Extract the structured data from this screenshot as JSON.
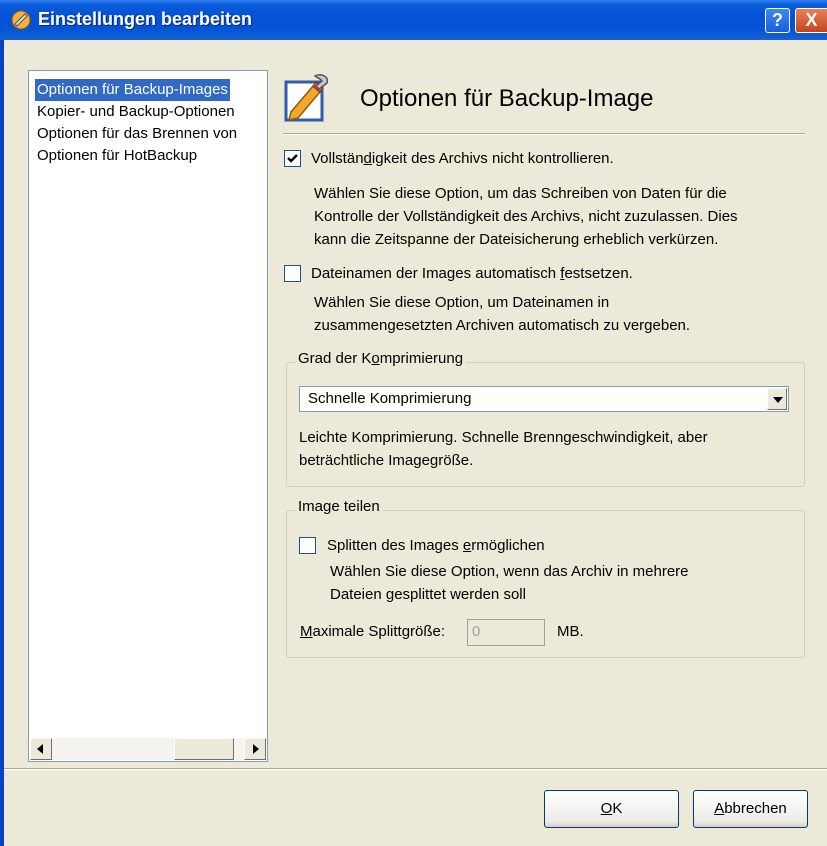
{
  "window": {
    "title": "Einstellungen bearbeiten",
    "help_label": "?",
    "close_label": "X"
  },
  "tree": {
    "items": [
      "Optionen für Backup-Images",
      "Kopier- und Backup-Optionen",
      "Optionen für das Brennen von",
      "Optionen für HotBackup"
    ],
    "selected_index": 0
  },
  "page": {
    "heading": "Optionen für Backup-Image"
  },
  "option_integrity": {
    "label_pre": "Vollstän",
    "label_key": "d",
    "label_post": "igkeit des Archivs nicht kontrollieren.",
    "checked": true,
    "description": [
      "Wählen Sie diese Option, um das Schreiben von Daten für die",
      "Kontrolle der Vollständigkeit des Archivs, nicht zuzulassen. Dies",
      "kann die Zeitspanne der Dateisicherung erheblich verkürzen."
    ]
  },
  "option_autoname": {
    "label_pre": "Dateinamen der Images automatisch ",
    "label_key": "f",
    "label_post": "estsetzen.",
    "checked": false,
    "description": [
      "Wählen Sie diese Option, um Dateinamen in",
      "zusammengesetzten Archiven automatisch zu vergeben."
    ]
  },
  "compression": {
    "legend_pre": "Grad der K",
    "legend_key": "o",
    "legend_post": "mprimierung",
    "selected": "Schnelle Komprimierung",
    "description": [
      "Leichte Komprimierung. Schnelle Brenngeschwindigkeit, aber",
      "beträchtliche Imagegröße."
    ]
  },
  "split": {
    "legend": "Image teilen",
    "checkbox_pre": "Splitten des Images ",
    "checkbox_key": "e",
    "checkbox_post": "rmöglichen",
    "checked": false,
    "description": [
      "Wählen Sie diese Option, wenn das Archiv in mehrere",
      "Dateien gesplittet werden soll"
    ],
    "max_label_key": "M",
    "max_label_post": "aximale Splittgröße:",
    "max_value": "0",
    "unit": "MB."
  },
  "buttons": {
    "ok_key": "O",
    "ok_post": "K",
    "cancel_key": "A",
    "cancel_post": "bbrechen"
  },
  "colors": {
    "titlebar": "#0452D6",
    "selection": "#316AC5",
    "dialog_bg": "#ECE9D8"
  },
  "icons": {
    "app": "settings-app-icon",
    "header": "settings-pencil-wrench-icon",
    "check": "checkmark-icon"
  }
}
